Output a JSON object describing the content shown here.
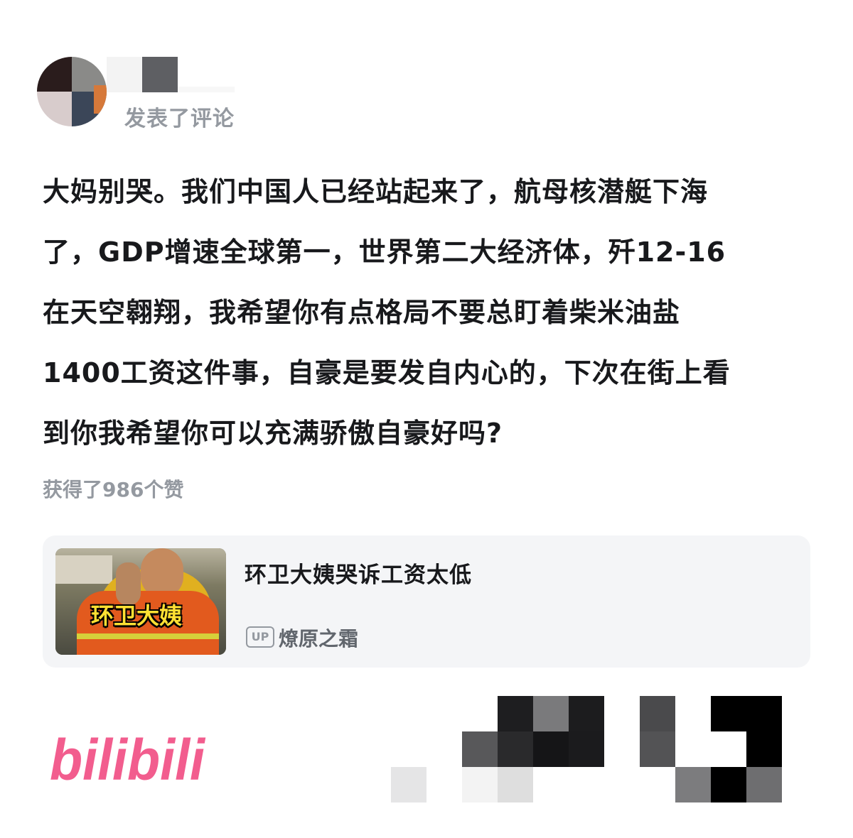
{
  "comment": {
    "action_text": "发表了评论",
    "lines": [
      "大妈别哭。我们中国人已经站起来了，航母核潜艇下海",
      "了，GDP增速全球第一，世界第二大经济体，歼12-16",
      "在天空翱翔，我希望你有点格局不要总盯着柴米油盐",
      "1400工资这件事，自豪是要发自内心的，下次在街上看",
      "到你我希望你可以充满骄傲自豪好吗?"
    ],
    "likes_text": "获得了986个赞"
  },
  "video_card": {
    "thumbnail_caption": "环卫大姨",
    "title": "环卫大姨哭诉工资太低",
    "up_badge": "UP",
    "uploader": "燎原之霜"
  },
  "brand": {
    "logo_text": "bilibili",
    "logo_color": "#f25d8e"
  },
  "icons": [
    "avatar",
    "up-icon",
    "bilibili-logo",
    "qr-code"
  ]
}
